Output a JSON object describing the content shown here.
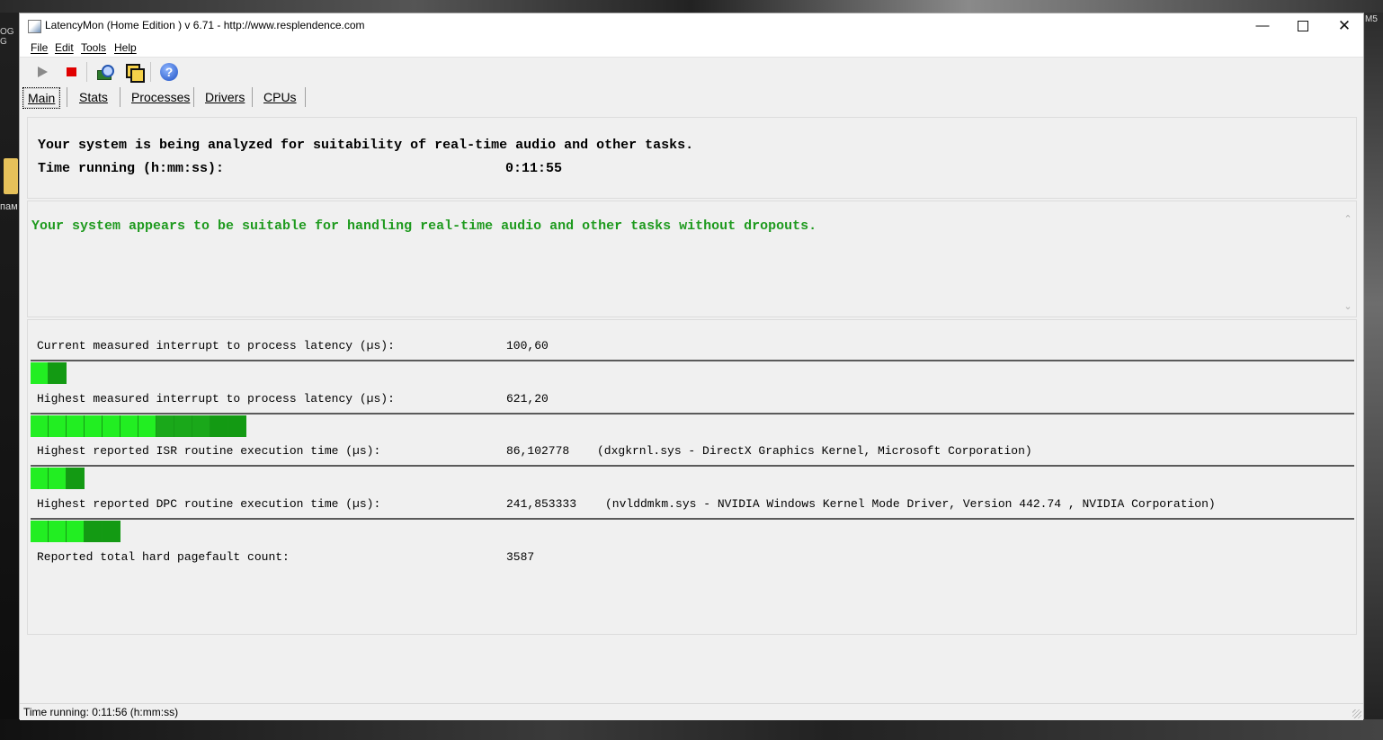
{
  "desktop": {
    "left_label": "пам",
    "left_top_label": "OG G",
    "right_label": "M5"
  },
  "window": {
    "title": "LatencyMon  (Home Edition )  v 6.71 - http://www.resplendence.com",
    "controls": {
      "minimize": "—",
      "close": "✕"
    }
  },
  "menu": [
    {
      "label": "File"
    },
    {
      "label": "Edit"
    },
    {
      "label": "Tools"
    },
    {
      "label": "Help"
    }
  ],
  "toolbar": {
    "icons": [
      "play-icon",
      "stop-icon",
      "inspect-icon",
      "windows-icon",
      "help-icon"
    ],
    "help_glyph": "?"
  },
  "tabs": [
    {
      "label": "Main",
      "active": true
    },
    {
      "label": "Stats",
      "active": false
    },
    {
      "label": "Processes",
      "active": false
    },
    {
      "label": "Drivers",
      "active": false
    },
    {
      "label": "CPUs",
      "active": false
    }
  ],
  "status_panel": {
    "line1": "Your system is being analyzed for suitability of real-time audio and other tasks.",
    "time_label": "Time running (h:mm:ss):",
    "time_value": "0:11:55"
  },
  "verdict": {
    "text": "Your system appears to be suitable for handling real-time audio and other tasks without dropouts.",
    "color": "#1e9a1e"
  },
  "metrics": [
    {
      "label": "Current measured interrupt to process latency (µs):",
      "value": "100,60",
      "detail": "",
      "bar_segments": 2
    },
    {
      "label": "Highest measured interrupt to process latency (µs):",
      "value": "621,20",
      "detail": "",
      "bar_segments": 12
    },
    {
      "label": "Highest reported ISR routine execution time (µs):",
      "value": "86,102778",
      "detail": "(dxgkrnl.sys - DirectX Graphics Kernel, Microsoft Corporation)",
      "bar_segments": 3
    },
    {
      "label": "Highest reported DPC routine execution time (µs):",
      "value": "241,853333",
      "detail": "(nvlddmkm.sys - NVIDIA Windows Kernel Mode Driver, Version 442.74 , NVIDIA Corporation)",
      "bar_segments": 5
    },
    {
      "label": "Reported total hard pagefault count:",
      "value": "3587",
      "detail": ""
    }
  ],
  "statusbar": {
    "text": "Time running: 0:11:56  (h:mm:ss)"
  },
  "colors": {
    "bar_bright": "#22ee22",
    "bar_dark": "#139a13",
    "track_line": "#5a5a5a"
  }
}
